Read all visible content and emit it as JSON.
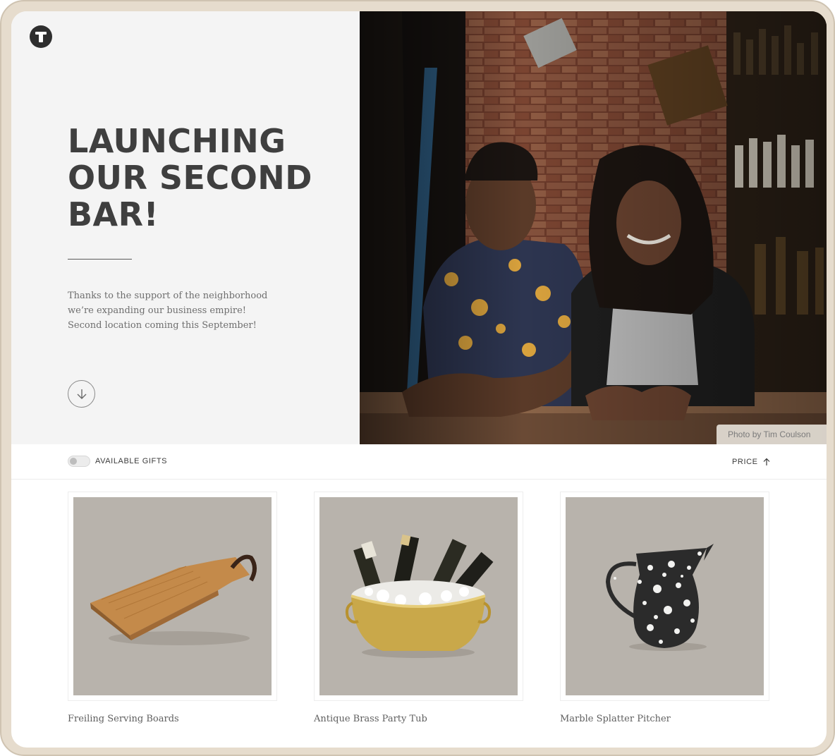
{
  "hero": {
    "headline": "LAUNCHING\nOUR SECOND\nBAR!",
    "blurb": "Thanks to the support of the neighborhood we’re expanding our business empire! Second location coming this September!",
    "photo_credit": "Photo by Tim Coulson",
    "scroll_icon": "arrow-down-circle-icon",
    "logo_icon": "t-logo-icon"
  },
  "filters": {
    "toggle_label": "AVAILABLE GIFTS",
    "toggle_on": false,
    "sort_label": "PRICE",
    "sort_icon": "arrow-up-icon"
  },
  "products": [
    {
      "name": "Freiling Serving Boards"
    },
    {
      "name": "Antique Brass Party Tub"
    },
    {
      "name": "Marble Splatter Pitcher"
    }
  ],
  "colors": {
    "frame": "#e6dccd",
    "hero_panel": "#f4f4f4",
    "product_bg": "#b8b3ac",
    "text_dark": "#3f3f3f"
  }
}
